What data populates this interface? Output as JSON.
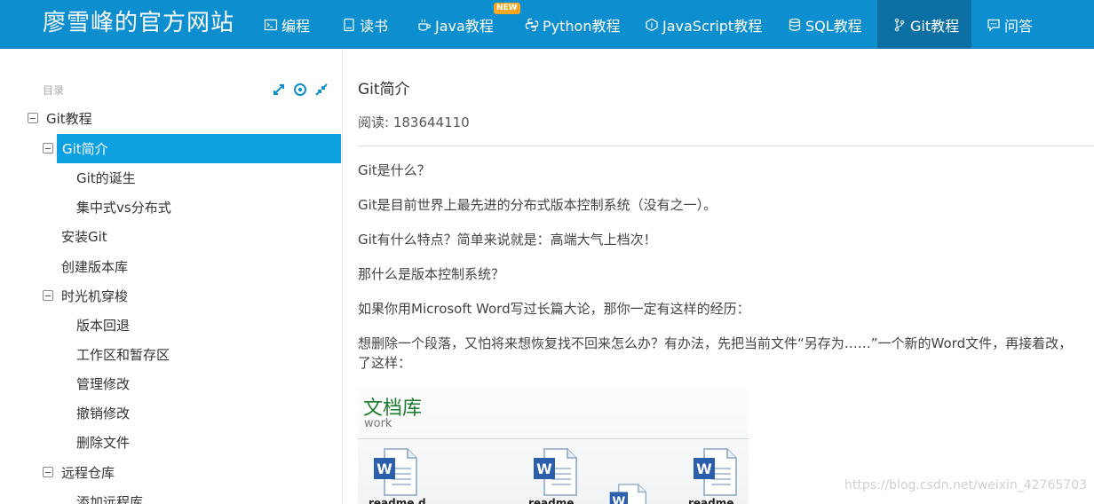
{
  "brand": "廖雪峰的官方网站",
  "nav": {
    "items": [
      {
        "label": "编程",
        "icon": "terminal-icon"
      },
      {
        "label": "读书",
        "icon": "book-icon"
      },
      {
        "label": "Java教程",
        "icon": "coffee-cup-icon",
        "badge": "NEW"
      },
      {
        "label": "Python教程",
        "icon": "python-icon"
      },
      {
        "label": "JavaScript教程",
        "icon": "js-hexagon-icon"
      },
      {
        "label": "SQL教程",
        "icon": "database-icon"
      },
      {
        "label": "Git教程",
        "icon": "git-branch-icon",
        "active": true
      },
      {
        "label": "问答",
        "icon": "chat-bubble-icon"
      }
    ],
    "active_color": "#0b6fa3",
    "bar_color": "#0d8ecf"
  },
  "sidebar": {
    "title": "目录",
    "tools": [
      "expand-icon",
      "target-icon",
      "collapse-icon"
    ],
    "tree": [
      {
        "label": "Git教程"
      },
      {
        "label": "Git简介",
        "active": true
      },
      {
        "label": "Git的诞生"
      },
      {
        "label": "集中式vs分布式"
      },
      {
        "label": "安装Git"
      },
      {
        "label": "创建版本库"
      },
      {
        "label": "时光机穿梭"
      },
      {
        "label": "版本回退"
      },
      {
        "label": "工作区和暂存区"
      },
      {
        "label": "管理修改"
      },
      {
        "label": "撤销修改"
      },
      {
        "label": "删除文件"
      },
      {
        "label": "远程仓库"
      },
      {
        "label": "添加远程库"
      }
    ]
  },
  "article": {
    "title": "Git简介",
    "read_count": "阅读: 183644110",
    "paragraphs": [
      "Git是什么？",
      "Git是目前世界上最先进的分布式版本控制系统（没有之一）。",
      "Git有什么特点？简单来说就是：高端大气上档次！",
      "那什么是版本控制系统？",
      "如果你用Microsoft Word写过长篇大论，那你一定有这样的经历：",
      "想删除一个段落，又怕将来想恢复找不回来怎么办？有办法，先把当前文件“另存为……”一个新的Word文件，再接着改，",
      "了这样："
    ],
    "figure": {
      "title": "文档库",
      "subtitle": "work",
      "files": [
        "readme.d",
        "readme",
        "readme"
      ]
    }
  },
  "watermark": "https://blog.csdn.net/weixin_42765703"
}
